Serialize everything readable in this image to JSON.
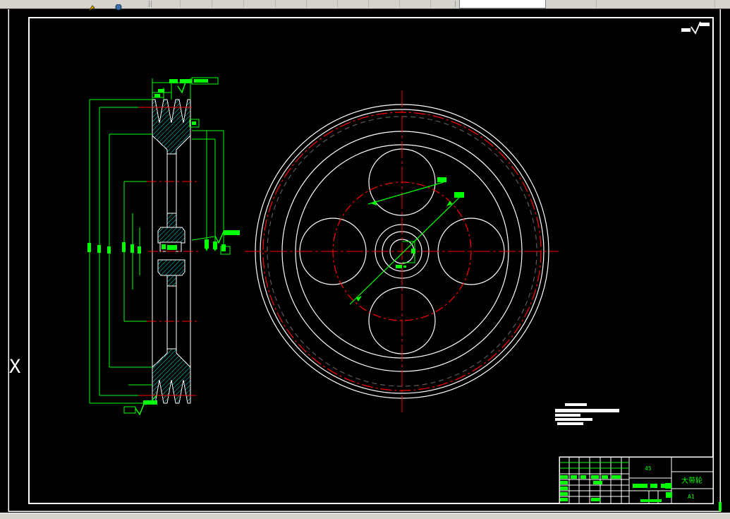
{
  "app": {
    "kind": "CAD drawing viewport",
    "toolbar_icons": [
      "edit-pencil-icon",
      "help-globe-icon"
    ],
    "canvas_background": "#000000"
  },
  "drawing": {
    "ucs_marker": "X",
    "views": {
      "section_view": "pulley cross-section with V-grooves, web and hub, cyan hatching",
      "front_view": "pulley front view: rim circles, 4 lightening holes, hub and keyway"
    },
    "colors": {
      "outline": "#ffffff",
      "dimension": "#00ff00",
      "centerline": "#ff0000",
      "hatch": "#00e0e0",
      "hidden_circle": "#5c5c5c"
    }
  },
  "title_block": {
    "material": "45",
    "part_name": "大带轮",
    "sheet_size": "A1"
  },
  "surface_finish": {
    "note": "roughness symbols (top-right of sheet, on section view)"
  }
}
